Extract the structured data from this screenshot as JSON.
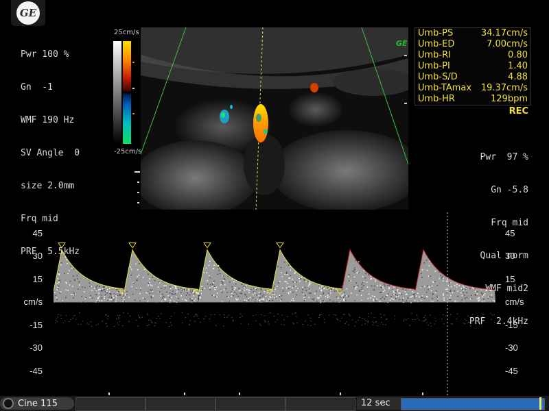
{
  "logo": {
    "text": "GE"
  },
  "params_left": [
    "Pwr 100 %",
    "Gn  -1",
    "WMF 190 Hz",
    "SV Angle  0",
    "size 2.0mm",
    "Frq mid",
    "PRF  5.5kHz"
  ],
  "color_bar": {
    "top_label": "25cm/s",
    "bottom_label": "-25cm/s"
  },
  "ge_mark": "GE",
  "measurements": [
    {
      "label": "Umb-PS",
      "value": "34.17cm/s"
    },
    {
      "label": "Umb-ED",
      "value": "7.00cm/s"
    },
    {
      "label": "Umb-RI",
      "value": "0.80"
    },
    {
      "label": "Umb-PI",
      "value": "1.40"
    },
    {
      "label": "Umb-S/D",
      "value": "4.88"
    },
    {
      "label": "Umb-TAmax",
      "value": "19.37cm/s"
    },
    {
      "label": "Umb-HR",
      "value": "129bpm"
    }
  ],
  "rec_label": "REC",
  "params_right": [
    "Pwr  97 %",
    "Gn -5.8",
    "Frq mid",
    "Qual norm",
    "WMF mid2",
    "PRF  2.4kHz"
  ],
  "spectral": {
    "unit": "cm/s",
    "scale_labels": [
      "45",
      "30",
      "15",
      "cm/s",
      "-15",
      "-30",
      "-45"
    ],
    "scale_values": [
      45,
      30,
      15,
      0,
      -15,
      -30,
      -45
    ]
  },
  "footer": {
    "cine_label": "Cine 115",
    "duration": "12 sec"
  },
  "colors": {
    "measure_text": "#f0e040",
    "trace_yellow": "#e8e040",
    "trace_red": "#c03030",
    "progress": "#2a6ab8"
  }
}
